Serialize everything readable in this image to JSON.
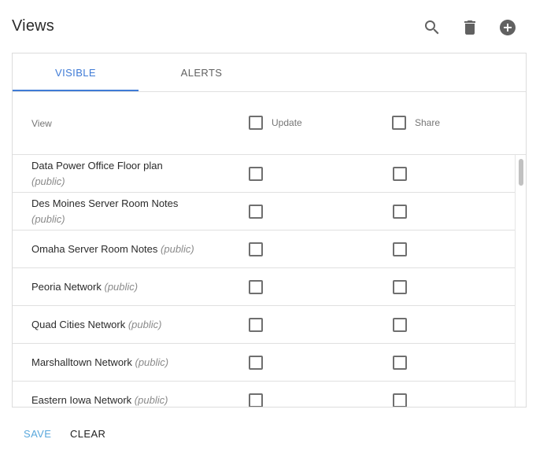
{
  "header": {
    "title": "Views",
    "icons": [
      "search-icon",
      "delete-icon",
      "add-circle-icon"
    ]
  },
  "tabs": [
    {
      "label": "VISIBLE",
      "active": true
    },
    {
      "label": "ALERTS",
      "active": false
    }
  ],
  "columns": {
    "view": "View",
    "update": "Update",
    "share": "Share"
  },
  "rows": [
    {
      "name": "Data Power Office Floor plan",
      "tag": "(public)"
    },
    {
      "name": "Des Moines Server Room Notes",
      "tag": "(public)"
    },
    {
      "name": "Omaha Server Room Notes",
      "tag": "(public)"
    },
    {
      "name": "Peoria Network",
      "tag": "(public)"
    },
    {
      "name": "Quad Cities Network",
      "tag": "(public)"
    },
    {
      "name": "Marshalltown Network",
      "tag": "(public)"
    },
    {
      "name": "Eastern Iowa Network",
      "tag": "(public)"
    }
  ],
  "footer": {
    "save_label": "SAVE",
    "clear_label": "CLEAR"
  },
  "colors": {
    "accent": "#3f7bd6",
    "save_text": "#5aa8dc",
    "icon": "#616161"
  }
}
